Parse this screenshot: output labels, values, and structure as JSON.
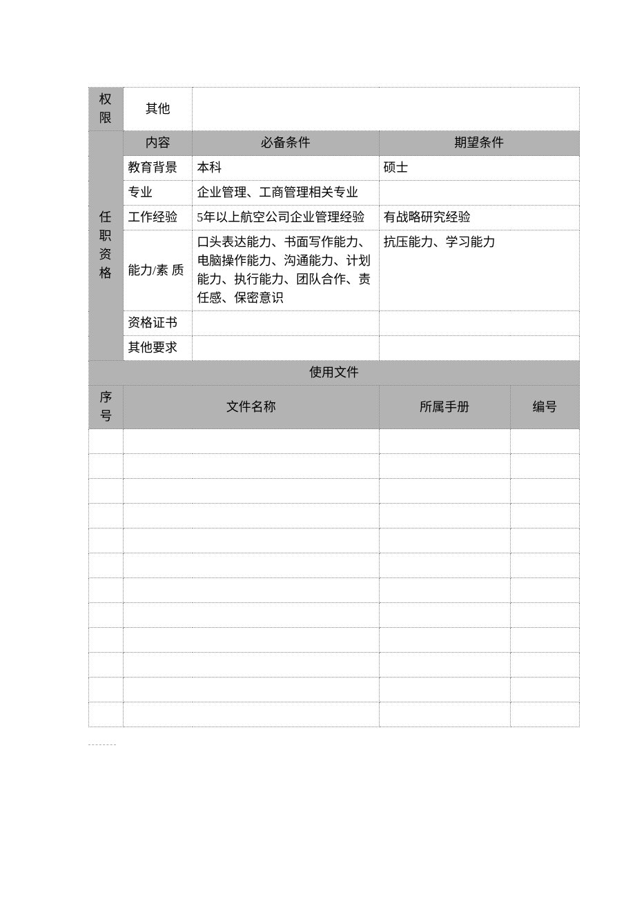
{
  "section1": {
    "permission_label": "权限",
    "other_label": "其他"
  },
  "qualifications": {
    "side_label_1": "任 职",
    "side_label_2": "资 格",
    "headers": {
      "content": "内容",
      "required": "必备条件",
      "desired": "期望条件"
    },
    "rows": {
      "edu": {
        "label": "教育背景",
        "required": "本科",
        "desired": "硕士"
      },
      "major": {
        "label": "专业",
        "required": "企业管理、工商管理相关专业",
        "desired": ""
      },
      "exp": {
        "label": "工作经验",
        "required": "5年以上航空公司企业管理经验",
        "desired": "有战略研究经验"
      },
      "ability": {
        "label": "能力/素 质",
        "required": "口头表达能力、书面写作能力、电脑操作能力、沟通能力、计划能力、执行能力、团队合作、责任感、保密意识",
        "desired": "抗压能力、学习能力"
      },
      "cert": {
        "label": "资格证书",
        "required": "",
        "desired": ""
      },
      "other": {
        "label": "其他要求",
        "required": "",
        "desired": ""
      }
    }
  },
  "files": {
    "title": "使用文件",
    "headers": {
      "seq": "序 号",
      "name": "文件名称",
      "manual": "所属手册",
      "no": "编号"
    }
  }
}
